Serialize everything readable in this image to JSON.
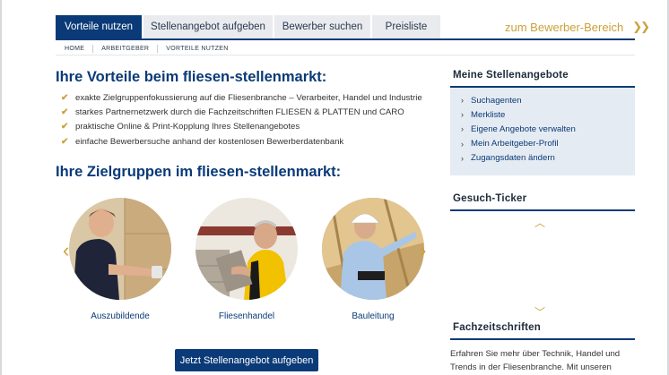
{
  "tabs": [
    {
      "label": "Vorteile nutzen",
      "active": true
    },
    {
      "label": "Stellenangebot aufgeben",
      "active": false
    },
    {
      "label": "Bewerber suchen",
      "active": false
    },
    {
      "label": "Preisliste",
      "active": false
    }
  ],
  "bewerber_link": {
    "label": "zum Bewerber-Bereich",
    "icon": "double-chevron-right-icon"
  },
  "breadcrumb": [
    "HOME",
    "ARBEITGEBER",
    "VORTEILE NUTZEN"
  ],
  "main": {
    "heading": "Ihre Vorteile beim fliesen-stellenmarkt:",
    "benefits": [
      "exakte Zielgruppenfokussierung auf die Fliesenbranche – Verarbeiter, Handel und Industrie",
      "starkes Partnernetzwerk durch die Fachzeitschriften FLIESEN & PLATTEN und CARO",
      "praktische Online & Print-Kopplung Ihres Stellenangebotes",
      "einfache Bewerbersuche anhand der kostenlosen Bewerberdatenbank"
    ],
    "targets_heading": "Ihre Zielgruppen im fliesen-stellenmarkt:",
    "targets": [
      {
        "label": "Auszubildende"
      },
      {
        "label": "Fliesenhandel"
      },
      {
        "label": "Bauleitung"
      }
    ],
    "cta": "Jetzt Stellenangebot aufgeben"
  },
  "sidebar": {
    "offers_title": "Meine Stellenangebote",
    "offers": [
      "Suchagenten",
      "Merkliste",
      "Eigene Angebote verwalten",
      "Mein Arbeitgeber-Profil",
      "Zugangsdaten ändern"
    ],
    "ticker_title": "Gesuch-Ticker",
    "fz_title": "Fachzeitschriften",
    "fz_text": "Erfahren Sie mehr über Technik, Handel und Trends in der Fliesenbranche. Mit unseren"
  },
  "colors": {
    "brand": "#0a3a78",
    "accent": "#c9a23a",
    "tab_bg": "#e9ebee",
    "box_bg": "#e5ebf2"
  }
}
